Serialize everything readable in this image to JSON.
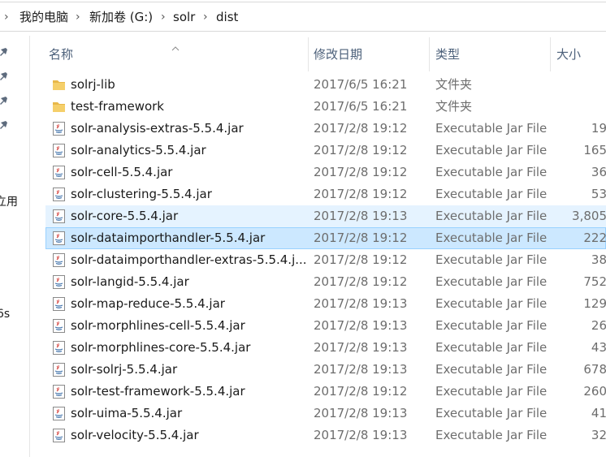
{
  "breadcrumb": {
    "items": [
      "我的电脑",
      "新加卷 (G:)",
      "solr",
      "dist"
    ]
  },
  "navpane": {
    "fragments": [
      "立用",
      "6s"
    ]
  },
  "columns": {
    "name": "名称",
    "date": "修改日期",
    "type": "类型",
    "size": "大小"
  },
  "files": [
    {
      "name": "solrj-lib",
      "date": "2017/6/5 16:21",
      "type": "文件夹",
      "size": "",
      "icon": "folder-icon",
      "state": "normal"
    },
    {
      "name": "test-framework",
      "date": "2017/6/5 16:21",
      "type": "文件夹",
      "size": "",
      "icon": "folder-icon",
      "state": "normal"
    },
    {
      "name": "solr-analysis-extras-5.5.4.jar",
      "date": "2017/2/8 19:12",
      "type": "Executable Jar File",
      "size": "19",
      "icon": "jar-icon",
      "state": "normal"
    },
    {
      "name": "solr-analytics-5.5.4.jar",
      "date": "2017/2/8 19:12",
      "type": "Executable Jar File",
      "size": "165",
      "icon": "jar-icon",
      "state": "normal"
    },
    {
      "name": "solr-cell-5.5.4.jar",
      "date": "2017/2/8 19:12",
      "type": "Executable Jar File",
      "size": "36",
      "icon": "jar-icon",
      "state": "normal"
    },
    {
      "name": "solr-clustering-5.5.4.jar",
      "date": "2017/2/8 19:12",
      "type": "Executable Jar File",
      "size": "53",
      "icon": "jar-icon",
      "state": "normal"
    },
    {
      "name": "solr-core-5.5.4.jar",
      "date": "2017/2/8 19:13",
      "type": "Executable Jar File",
      "size": "3,805",
      "icon": "jar-icon",
      "state": "hover"
    },
    {
      "name": "solr-dataimporthandler-5.5.4.jar",
      "date": "2017/2/8 19:12",
      "type": "Executable Jar File",
      "size": "222",
      "icon": "jar-icon",
      "state": "selected"
    },
    {
      "name": "solr-dataimporthandler-extras-5.5.4.j...",
      "date": "2017/2/8 19:12",
      "type": "Executable Jar File",
      "size": "38",
      "icon": "jar-icon",
      "state": "normal"
    },
    {
      "name": "solr-langid-5.5.4.jar",
      "date": "2017/2/8 19:12",
      "type": "Executable Jar File",
      "size": "752",
      "icon": "jar-icon",
      "state": "normal"
    },
    {
      "name": "solr-map-reduce-5.5.4.jar",
      "date": "2017/2/8 19:13",
      "type": "Executable Jar File",
      "size": "129",
      "icon": "jar-icon",
      "state": "normal"
    },
    {
      "name": "solr-morphlines-cell-5.5.4.jar",
      "date": "2017/2/8 19:13",
      "type": "Executable Jar File",
      "size": "26",
      "icon": "jar-icon",
      "state": "normal"
    },
    {
      "name": "solr-morphlines-core-5.5.4.jar",
      "date": "2017/2/8 19:13",
      "type": "Executable Jar File",
      "size": "43",
      "icon": "jar-icon",
      "state": "normal"
    },
    {
      "name": "solr-solrj-5.5.4.jar",
      "date": "2017/2/8 19:13",
      "type": "Executable Jar File",
      "size": "678",
      "icon": "jar-icon",
      "state": "normal"
    },
    {
      "name": "solr-test-framework-5.5.4.jar",
      "date": "2017/2/8 19:12",
      "type": "Executable Jar File",
      "size": "260",
      "icon": "jar-icon",
      "state": "normal"
    },
    {
      "name": "solr-uima-5.5.4.jar",
      "date": "2017/2/8 19:13",
      "type": "Executable Jar File",
      "size": "41",
      "icon": "jar-icon",
      "state": "normal"
    },
    {
      "name": "solr-velocity-5.5.4.jar",
      "date": "2017/2/8 19:13",
      "type": "Executable Jar File",
      "size": "32",
      "icon": "jar-icon",
      "state": "normal"
    }
  ],
  "colors": {
    "hover_bg": "#e5f3ff",
    "selected_bg": "#cce8ff",
    "selected_border": "#99d1ff",
    "header_text": "#4c607a",
    "folder": "#e8b84a"
  }
}
